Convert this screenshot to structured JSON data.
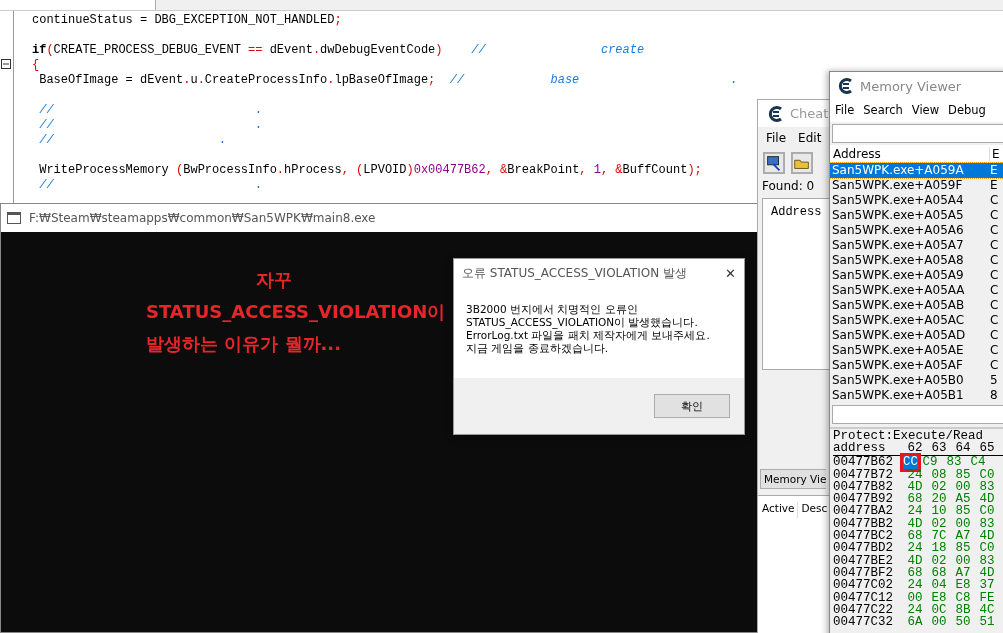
{
  "editor": {
    "lines": [
      {
        "kind": "code",
        "segments": [
          {
            "kind": "plain",
            "text": "continueStatus = DBG_EXCEPTION_NOT_HANDLED"
          },
          {
            "kind": "op",
            "text": ";"
          }
        ]
      },
      {
        "kind": "blank"
      },
      {
        "kind": "code",
        "segments": [
          {
            "kind": "keyword",
            "text": "if"
          },
          {
            "kind": "op",
            "text": "("
          },
          {
            "kind": "plain",
            "text": "CREATE_PROCESS_DEBUG_EVENT "
          },
          {
            "kind": "op",
            "text": "=="
          },
          {
            "kind": "plain",
            "text": " dEvent"
          },
          {
            "kind": "op",
            "text": "."
          },
          {
            "kind": "plain",
            "text": "dwDebugEventCode"
          },
          {
            "kind": "op",
            "text": ")"
          },
          {
            "kind": "comment",
            "text": "    //                create"
          }
        ]
      },
      {
        "kind": "code",
        "segments": [
          {
            "kind": "op",
            "text": "{"
          }
        ]
      },
      {
        "kind": "code",
        "segments": [
          {
            "kind": "plain",
            "text": " BaseOfImage = dEvent"
          },
          {
            "kind": "op",
            "text": "."
          },
          {
            "kind": "plain",
            "text": "u"
          },
          {
            "kind": "op",
            "text": "."
          },
          {
            "kind": "plain",
            "text": "CreateProcessInfo"
          },
          {
            "kind": "op",
            "text": "."
          },
          {
            "kind": "plain",
            "text": "lpBaseOfImage"
          },
          {
            "kind": "op",
            "text": ";"
          },
          {
            "kind": "comment",
            "text": "  //            base                     ."
          }
        ]
      },
      {
        "kind": "blank"
      },
      {
        "kind": "code",
        "segments": [
          {
            "kind": "comment",
            "text": " //                            ."
          }
        ]
      },
      {
        "kind": "code",
        "segments": [
          {
            "kind": "comment",
            "text": " //                            ."
          }
        ]
      },
      {
        "kind": "code",
        "segments": [
          {
            "kind": "comment",
            "text": " //                       ."
          }
        ]
      },
      {
        "kind": "blank"
      },
      {
        "kind": "code",
        "segments": [
          {
            "kind": "plain",
            "text": " WriteProcessMemory "
          },
          {
            "kind": "op",
            "text": "("
          },
          {
            "kind": "plain",
            "text": "BwProcessInfo"
          },
          {
            "kind": "op",
            "text": "."
          },
          {
            "kind": "plain",
            "text": "hProcess"
          },
          {
            "kind": "op",
            "text": ", ("
          },
          {
            "kind": "plain",
            "text": "LPVOID"
          },
          {
            "kind": "op",
            "text": ")"
          },
          {
            "kind": "num",
            "text": "0x00477B62"
          },
          {
            "kind": "op",
            "text": ", &"
          },
          {
            "kind": "plain",
            "text": "BreakPoint"
          },
          {
            "kind": "op",
            "text": ", "
          },
          {
            "kind": "num",
            "text": "1"
          },
          {
            "kind": "op",
            "text": ", &"
          },
          {
            "kind": "plain",
            "text": "BuffCount"
          },
          {
            "kind": "op",
            "text": ");"
          }
        ]
      },
      {
        "kind": "code",
        "segments": [
          {
            "kind": "comment",
            "text": " //                            ."
          }
        ]
      }
    ]
  },
  "console": {
    "title": "F:₩Steam₩steamapps₩common₩San5WPK₩main8.exe",
    "message_lines": [
      "자꾸",
      "STATUS_ACCESS_VIOLATION이",
      "발생하는 이유가 뭘까..."
    ]
  },
  "error_dialog": {
    "title": "오류 STATUS_ACCESS_VIOLATION 발생",
    "close": "✕",
    "message": "3B2000 번지에서 치명적인 오류인\nSTATUS_ACCESS_VIOLATION이 발생했습니다.\nErrorLog.txt 파일을 패치 제작자에게 보내주세요.\n지금 게임을 종료하겠습니다.",
    "button": "확인"
  },
  "cheat_engine": {
    "title": "Cheat",
    "menu": [
      "File",
      "Edit"
    ],
    "found": "Found: 0",
    "results_header": "Address",
    "memory_view_button": "Memory Vie",
    "table_columns": [
      "Active",
      "Desc"
    ]
  },
  "memory_viewer": {
    "title": "Memory Viewer",
    "menu": [
      "File",
      "Search",
      "View",
      "Debug"
    ],
    "columns": [
      "Address",
      "E"
    ],
    "rows": [
      {
        "address": "San5WPK.exe+A059A",
        "column_2": "E",
        "selected": true
      },
      {
        "address": "San5WPK.exe+A059F",
        "column_2": "E",
        "selected": false
      },
      {
        "address": "San5WPK.exe+A05A4",
        "column_2": "C",
        "selected": false
      },
      {
        "address": "San5WPK.exe+A05A5",
        "column_2": "C",
        "selected": false
      },
      {
        "address": "San5WPK.exe+A05A6",
        "column_2": "C",
        "selected": false
      },
      {
        "address": "San5WPK.exe+A05A7",
        "column_2": "C",
        "selected": false
      },
      {
        "address": "San5WPK.exe+A05A8",
        "column_2": "C",
        "selected": false
      },
      {
        "address": "San5WPK.exe+A05A9",
        "column_2": "C",
        "selected": false
      },
      {
        "address": "San5WPK.exe+A05AA",
        "column_2": "C",
        "selected": false
      },
      {
        "address": "San5WPK.exe+A05AB",
        "column_2": "C",
        "selected": false
      },
      {
        "address": "San5WPK.exe+A05AC",
        "column_2": "C",
        "selected": false
      },
      {
        "address": "San5WPK.exe+A05AD",
        "column_2": "C",
        "selected": false
      },
      {
        "address": "San5WPK.exe+A05AE",
        "column_2": "C",
        "selected": false
      },
      {
        "address": "San5WPK.exe+A05AF",
        "column_2": "C",
        "selected": false
      },
      {
        "address": "San5WPK.exe+A05B0",
        "column_2": "5",
        "selected": false
      },
      {
        "address": "San5WPK.exe+A05B1",
        "column_2": "8",
        "selected": false
      }
    ],
    "hex_view": {
      "protect": "Protect:Execute/Read",
      "address_header": "address",
      "byte_headers": [
        "62",
        "63",
        "64",
        "65"
      ],
      "rows": [
        {
          "address": "00477B62",
          "bytes": [
            {
              "value": "CC",
              "selected": true,
              "highlighted": true
            },
            {
              "value": "C9",
              "selected": false,
              "highlighted": false
            },
            {
              "value": "83",
              "selected": false,
              "highlighted": false
            },
            {
              "value": "C4",
              "selected": false,
              "highlighted": false
            }
          ]
        },
        {
          "address": "00477B72",
          "bytes": [
            {
              "value": "24",
              "selected": false,
              "highlighted": false
            },
            {
              "value": "08",
              "selected": false,
              "highlighted": false
            },
            {
              "value": "85",
              "selected": false,
              "highlighted": false
            },
            {
              "value": "C0",
              "selected": false,
              "highlighted": false
            }
          ]
        },
        {
          "address": "00477B82",
          "bytes": [
            {
              "value": "4D",
              "selected": false,
              "highlighted": false
            },
            {
              "value": "02",
              "selected": false,
              "highlighted": false
            },
            {
              "value": "00",
              "selected": false,
              "highlighted": false
            },
            {
              "value": "83",
              "selected": false,
              "highlighted": false
            }
          ]
        },
        {
          "address": "00477B92",
          "bytes": [
            {
              "value": "68",
              "selected": false,
              "highlighted": false
            },
            {
              "value": "20",
              "selected": false,
              "highlighted": false
            },
            {
              "value": "A5",
              "selected": false,
              "highlighted": false
            },
            {
              "value": "4D",
              "selected": false,
              "highlighted": false
            }
          ]
        },
        {
          "address": "00477BA2",
          "bytes": [
            {
              "value": "24",
              "selected": false,
              "highlighted": false
            },
            {
              "value": "10",
              "selected": false,
              "highlighted": false
            },
            {
              "value": "85",
              "selected": false,
              "highlighted": false
            },
            {
              "value": "C0",
              "selected": false,
              "highlighted": false
            }
          ]
        },
        {
          "address": "00477BB2",
          "bytes": [
            {
              "value": "4D",
              "selected": false,
              "highlighted": false
            },
            {
              "value": "02",
              "selected": false,
              "highlighted": false
            },
            {
              "value": "00",
              "selected": false,
              "highlighted": false
            },
            {
              "value": "83",
              "selected": false,
              "highlighted": false
            }
          ]
        },
        {
          "address": "00477BC2",
          "bytes": [
            {
              "value": "68",
              "selected": false,
              "highlighted": false
            },
            {
              "value": "7C",
              "selected": false,
              "highlighted": false
            },
            {
              "value": "A7",
              "selected": false,
              "highlighted": false
            },
            {
              "value": "4D",
              "selected": false,
              "highlighted": false
            }
          ]
        },
        {
          "address": "00477BD2",
          "bytes": [
            {
              "value": "24",
              "selected": false,
              "highlighted": false
            },
            {
              "value": "18",
              "selected": false,
              "highlighted": false
            },
            {
              "value": "85",
              "selected": false,
              "highlighted": false
            },
            {
              "value": "C0",
              "selected": false,
              "highlighted": false
            }
          ]
        },
        {
          "address": "00477BE2",
          "bytes": [
            {
              "value": "4D",
              "selected": false,
              "highlighted": false
            },
            {
              "value": "02",
              "selected": false,
              "highlighted": false
            },
            {
              "value": "00",
              "selected": false,
              "highlighted": false
            },
            {
              "value": "83",
              "selected": false,
              "highlighted": false
            }
          ]
        },
        {
          "address": "00477BF2",
          "bytes": [
            {
              "value": "68",
              "selected": false,
              "highlighted": false
            },
            {
              "value": "68",
              "selected": false,
              "highlighted": false
            },
            {
              "value": "A7",
              "selected": false,
              "highlighted": false
            },
            {
              "value": "4D",
              "selected": false,
              "highlighted": false
            }
          ]
        },
        {
          "address": "00477C02",
          "bytes": [
            {
              "value": "24",
              "selected": false,
              "highlighted": false
            },
            {
              "value": "04",
              "selected": false,
              "highlighted": false
            },
            {
              "value": "E8",
              "selected": false,
              "highlighted": false
            },
            {
              "value": "37",
              "selected": false,
              "highlighted": false
            }
          ]
        },
        {
          "address": "00477C12",
          "bytes": [
            {
              "value": "00",
              "selected": false,
              "highlighted": false
            },
            {
              "value": "E8",
              "selected": false,
              "highlighted": false
            },
            {
              "value": "C8",
              "selected": false,
              "highlighted": false
            },
            {
              "value": "FE",
              "selected": false,
              "highlighted": false
            }
          ]
        },
        {
          "address": "00477C22",
          "bytes": [
            {
              "value": "24",
              "selected": false,
              "highlighted": false
            },
            {
              "value": "0C",
              "selected": false,
              "highlighted": false
            },
            {
              "value": "8B",
              "selected": false,
              "highlighted": false
            },
            {
              "value": "4C",
              "selected": false,
              "highlighted": false
            }
          ]
        },
        {
          "address": "00477C32",
          "bytes": [
            {
              "value": "6A",
              "selected": false,
              "highlighted": false
            },
            {
              "value": "00",
              "selected": false,
              "highlighted": false
            },
            {
              "value": "50",
              "selected": false,
              "highlighted": false
            },
            {
              "value": "51",
              "selected": false,
              "highlighted": false
            }
          ]
        }
      ]
    }
  }
}
